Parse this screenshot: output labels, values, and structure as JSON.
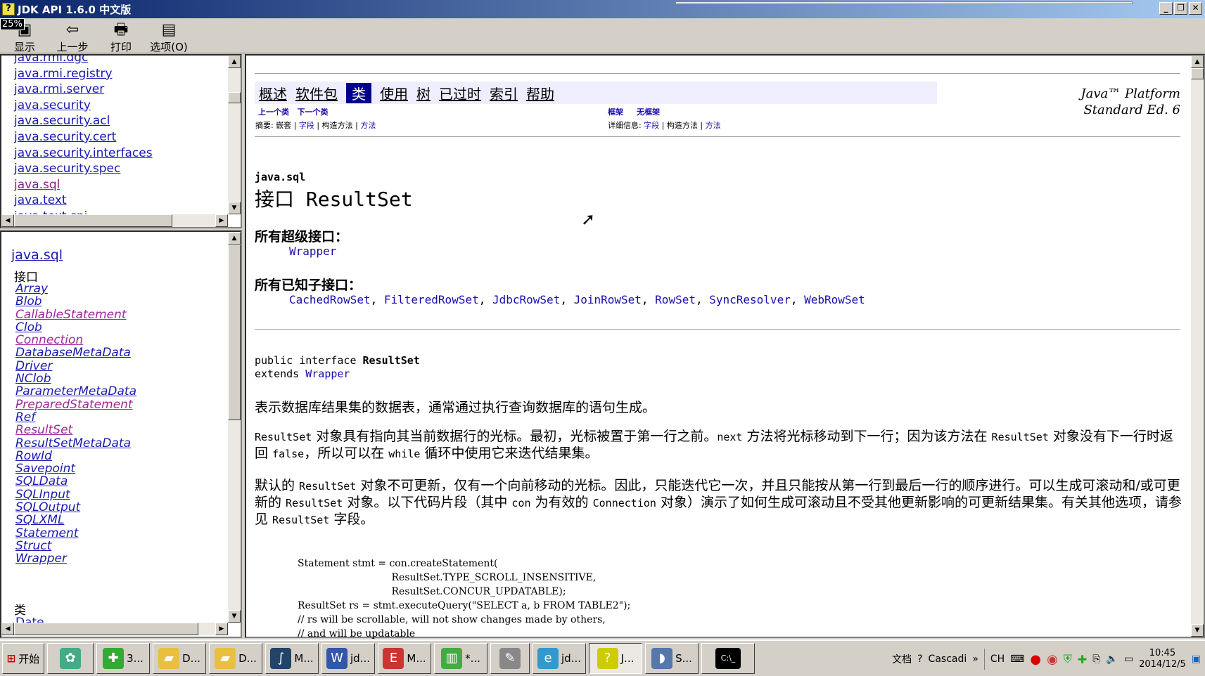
{
  "window": {
    "title": "JDK API 1.6.0 中文版",
    "zoom_badge": "25%",
    "buttons": [
      "_",
      "❐",
      "✕"
    ]
  },
  "toolbar": {
    "show": "显示",
    "back": "上一步",
    "print": "打印",
    "options": "选项(O)"
  },
  "package_list": [
    "java.rmi.dgc",
    "java.rmi.registry",
    "java.rmi.server",
    "java.security",
    "java.security.acl",
    "java.security.cert",
    "java.security.interfaces",
    "java.security.spec",
    "java.sql",
    "java.text",
    "java.text.spi"
  ],
  "class_pane": {
    "package": "java.sql",
    "interfaces_heading": "接口",
    "interfaces": [
      "Array",
      "Blob",
      "CallableStatement",
      "Clob",
      "Connection",
      "DatabaseMetaData",
      "Driver",
      "NClob",
      "ParameterMetaData",
      "PreparedStatement",
      "Ref",
      "ResultSet",
      "ResultSetMetaData",
      "RowId",
      "Savepoint",
      "SQLData",
      "SQLInput",
      "SQLOutput",
      "SQLXML",
      "Statement",
      "Struct",
      "Wrapper"
    ],
    "classes_heading": "类",
    "classes": [
      "Date"
    ]
  },
  "nav": {
    "items": [
      "概述",
      "软件包",
      "类",
      "使用",
      "树",
      "已过时",
      "索引",
      "帮助"
    ],
    "current": "类",
    "prev_class": "上一个类",
    "next_class": "下一个类",
    "frames": "框架",
    "no_frames": "无框架",
    "summary": "摘要:",
    "summary_nested": "嵌套",
    "summary_field": "字段",
    "summary_ctor": "构造方法",
    "summary_method": "方法",
    "detail": "详细信息:",
    "detail_field": "字段",
    "detail_ctor": "构造方法",
    "detail_method": "方法"
  },
  "platform": {
    "line1": "Java™ Platform",
    "line2": "Standard Ed. 6"
  },
  "doc": {
    "package": "java.sql",
    "title": "接口 ResultSet",
    "super_heading": "所有超级接口：",
    "super_list": [
      "Wrapper"
    ],
    "sub_heading": "所有已知子接口：",
    "sub_list": [
      "CachedRowSet",
      "FilteredRowSet",
      "JdbcRowSet",
      "JoinRowSet",
      "RowSet",
      "SyncResolver",
      "WebRowSet"
    ],
    "decl_prefix": "public interface ",
    "decl_name": "ResultSet",
    "extends_prefix": "extends ",
    "extends_name": "Wrapper",
    "p1": "表示数据库结果集的数据表，通常通过执行查询数据库的语句生成。",
    "p2a": "ResultSet",
    "p2b": " 对象具有指向其当前数据行的光标。最初，光标被置于第一行之前。",
    "p2c": "next",
    "p2d": " 方法将光标移动到下一行；因为该方法在 ",
    "p2e": "ResultSet",
    "p2f": " 对象没有下一行时返回 ",
    "p2g": "false",
    "p2h": "，所以可以在 ",
    "p2i": "while",
    "p2j": " 循环中使用它来迭代结果集。",
    "p3a": "默认的 ",
    "p3b": "ResultSet",
    "p3c": " 对象不可更新，仅有一个向前移动的光标。因此，只能迭代它一次，并且只能按从第一行到最后一行的顺序进行。可以生成可滚动和/或可更新的 ",
    "p3d": "ResultSet",
    "p3e": " 对象。以下代码片段（其中 ",
    "p3f": "con",
    "p3g": " 为有效的 ",
    "p3h": "Connection",
    "p3i": " 对象）演示了如何生成可滚动且不受其他更新影响的可更新结果集。有关其他选项，请参见 ",
    "p3j": "ResultSet",
    "p3k": " 字段。",
    "code": [
      "Statement stmt = con.createStatement(",
      "                              ResultSet.TYPE_SCROLL_INSENSITIVE,",
      "                              ResultSet.CONCUR_UPDATABLE);",
      "ResultSet rs = stmt.executeQuery(\"SELECT a, b FROM TABLE2\");",
      "// rs will be scrollable, will not show changes made by others,",
      "// and will be updatable"
    ]
  },
  "taskbar": {
    "start": "开始",
    "items": [
      {
        "label": "3...",
        "icon": "plus-icon"
      },
      {
        "label": "D...",
        "icon": "folder-icon"
      },
      {
        "label": "D...",
        "icon": "folder-icon"
      },
      {
        "label": "M...",
        "icon": "app-icon"
      },
      {
        "label": "jd...",
        "icon": "word-icon"
      },
      {
        "label": "M...",
        "icon": "ec-icon"
      },
      {
        "label": "*...",
        "icon": "chart-icon"
      },
      {
        "label": "jd...",
        "icon": "ie-icon"
      },
      {
        "label": "J...",
        "icon": "help-icon"
      },
      {
        "label": "S...",
        "icon": "dolphin-icon"
      }
    ],
    "docs": "文档",
    "cascade": "Cascadi",
    "lang": "CH",
    "time": "10:45",
    "date": "2014/12/5"
  }
}
